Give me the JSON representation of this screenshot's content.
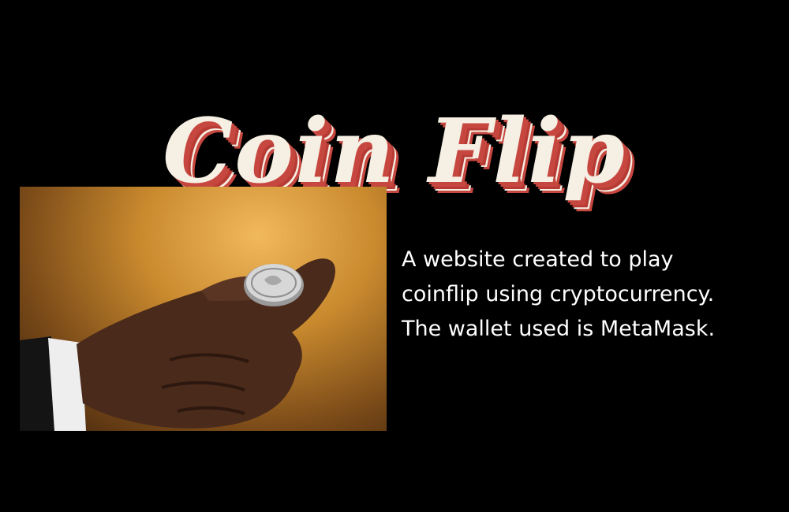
{
  "title": "Coin Flip",
  "description_lines": [
    "A website created to play",
    "coinflip using cryptocurrency.",
    "The wallet used is MetaMask."
  ],
  "colors": {
    "background": "#000000",
    "title_fill": "#f6efe3",
    "title_shadow": "#c6473f",
    "text": "#ffffff"
  }
}
